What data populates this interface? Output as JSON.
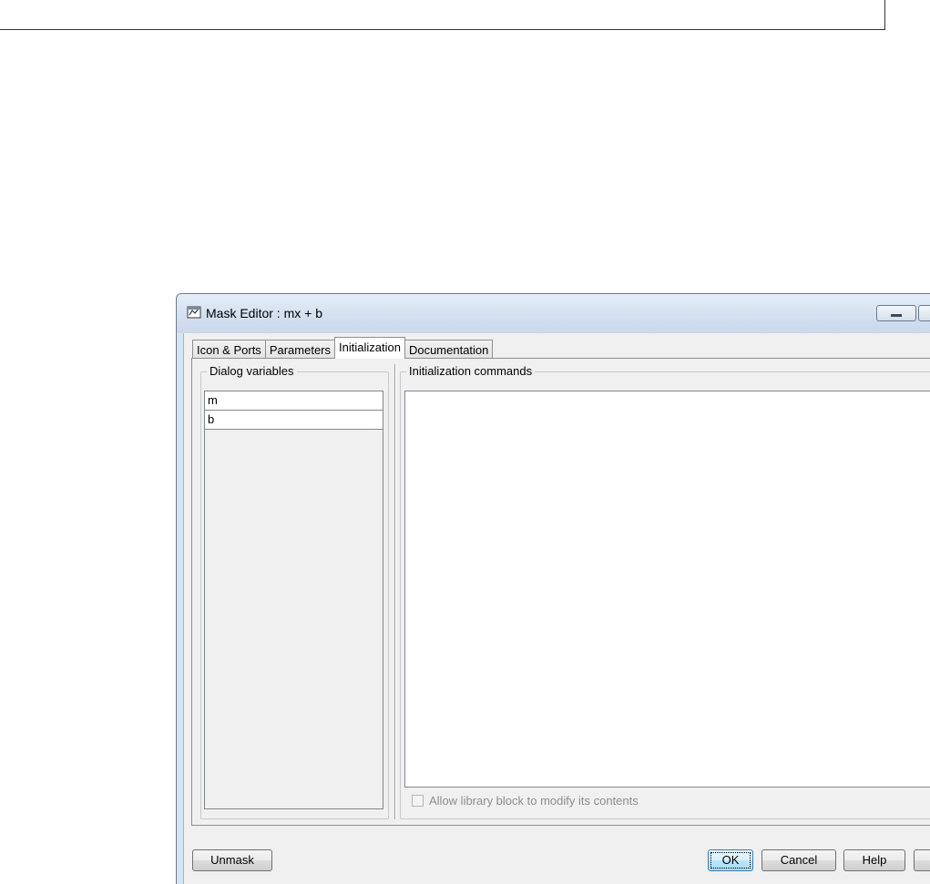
{
  "window": {
    "title": "Mask Editor : mx + b"
  },
  "tabs": [
    {
      "label": "Icon & Ports",
      "active": false
    },
    {
      "label": "Parameters",
      "active": false
    },
    {
      "label": "Initialization",
      "active": true
    },
    {
      "label": "Documentation",
      "active": false
    }
  ],
  "dialog_variables": {
    "title": "Dialog variables",
    "items": [
      "m",
      "b"
    ]
  },
  "initialization": {
    "title": "Initialization commands",
    "commands": "",
    "allow_modify_label": "Allow library block to modify its contents",
    "allow_modify_checked": false
  },
  "buttons": {
    "unmask": "Unmask",
    "ok": "OK",
    "cancel": "Cancel",
    "help": "Help"
  },
  "colors": {
    "titlebar": "#d3e0ef",
    "client": "#f0f0f0",
    "default_button": "#bee6fd"
  }
}
